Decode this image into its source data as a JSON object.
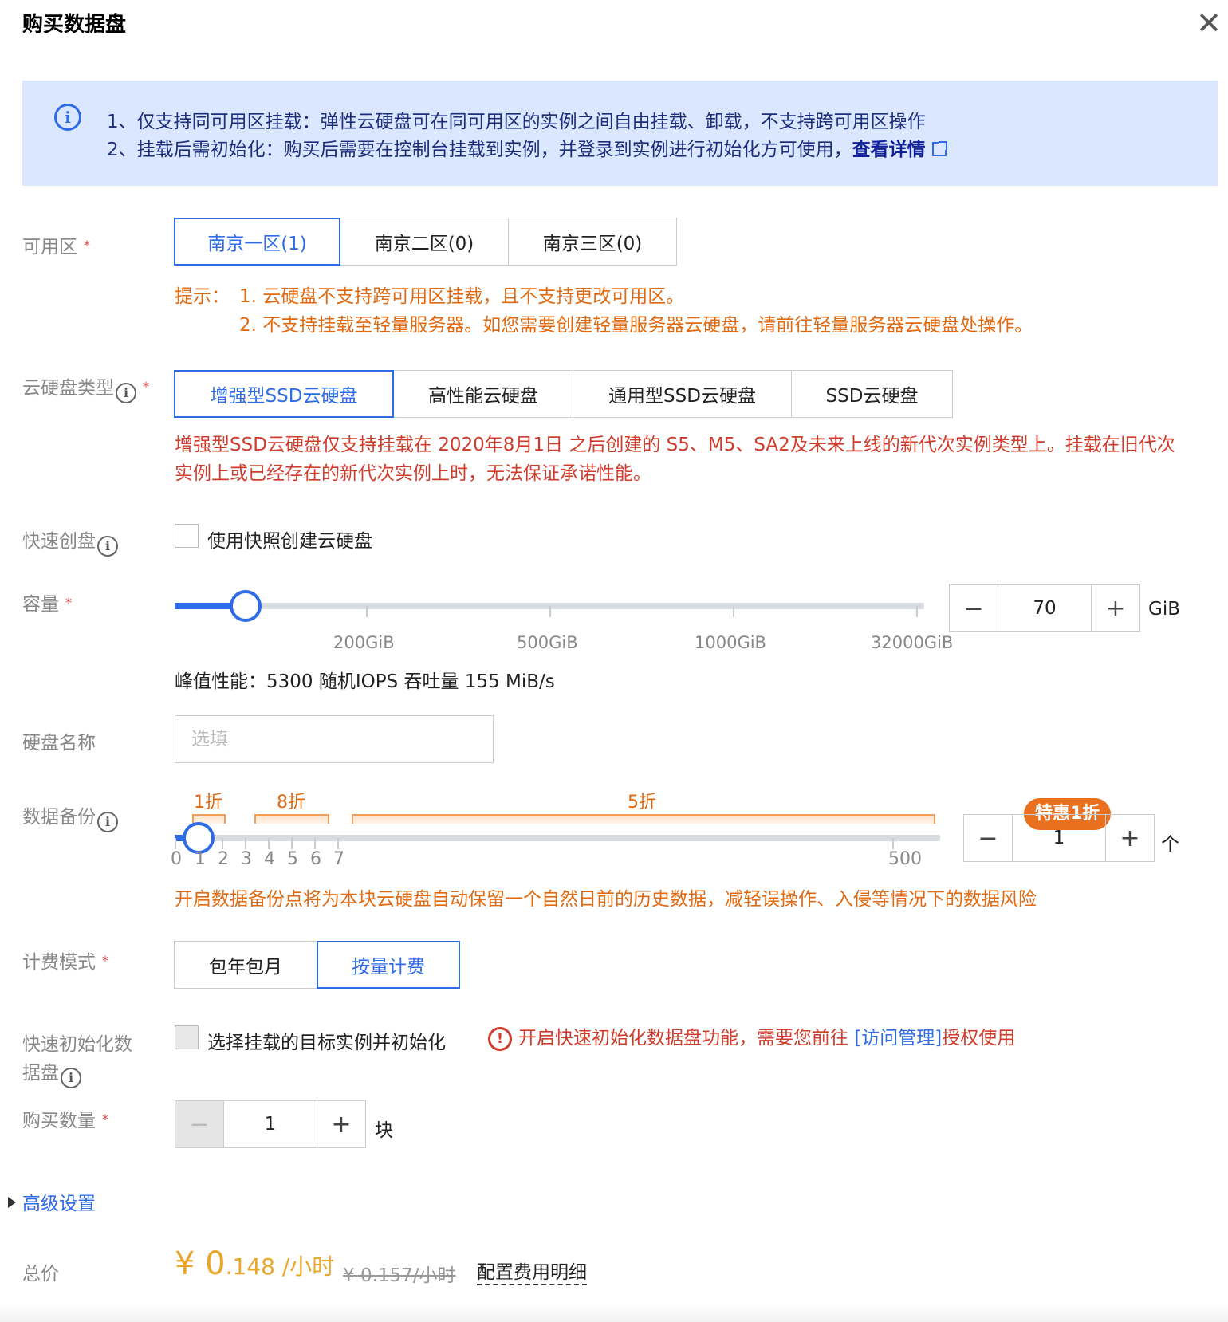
{
  "dialog": {
    "title": "购买数据盘",
    "close_glyph": "✕"
  },
  "notice": {
    "line1": "1、仅支持同可用区挂载：弹性云硬盘可在同可用区的实例之间自由挂载、卸载，不支持跨可用区操作",
    "line2": "2、挂载后需初始化：购买后需要在控制台挂载到实例，并登录到实例进行初始化方可使用，",
    "link": "查看详情"
  },
  "zone": {
    "label": "可用区",
    "options": [
      "南京一区(1)",
      "南京二区(0)",
      "南京三区(0)"
    ],
    "selected": "南京一区(1)",
    "tip_prefix": "提示：",
    "tip1": "1. 云硬盘不支持跨可用区挂载，且不支持更改可用区。",
    "tip2": "2. 不支持挂载至轻量服务器。如您需要创建轻量服务器云硬盘，请前往轻量服务器云硬盘处操作。"
  },
  "disk_type": {
    "label": "云硬盘类型",
    "options": [
      "增强型SSD云硬盘",
      "高性能云硬盘",
      "通用型SSD云硬盘",
      "SSD云硬盘"
    ],
    "selected": "增强型SSD云硬盘",
    "warning": "增强型SSD云硬盘仅支持挂载在 2020年8月1日 之后创建的 S5、M5、SA2及未来上线的新代次实例类型上。挂载在旧代次实例上或已经存在的新代次实例上时，无法保证承诺性能。"
  },
  "quick_create": {
    "label": "快速创盘",
    "checkbox_label": "使用快照创建云硬盘",
    "checked": false
  },
  "capacity": {
    "label": "容量",
    "ticks": [
      "200GiB",
      "500GiB",
      "1000GiB",
      "32000GiB"
    ],
    "slider_fraction": 0.095,
    "value": "70",
    "unit": "GiB",
    "perf": "峰值性能：5300 随机IOPS 吞吐量 155 MiB/s"
  },
  "disk_name": {
    "label": "硬盘名称",
    "placeholder": "选填"
  },
  "backup": {
    "label": "数据备份",
    "discounts": [
      "1折",
      "8折",
      "5折"
    ],
    "badge": "特惠1折",
    "ticks": [
      "0",
      "1",
      "2",
      "3",
      "4",
      "5",
      "6",
      "7",
      "500"
    ],
    "slider_value": 1,
    "value": "1",
    "unit": "个",
    "hint": "开启数据备份点将为本块云硬盘自动保留一个自然日前的历史数据，减轻误操作、入侵等情况下的数据风险"
  },
  "billing": {
    "label": "计费模式",
    "options": [
      "包年包月",
      "按量计费"
    ],
    "selected": "按量计费"
  },
  "quick_init": {
    "label_line1": "快速初始化数",
    "label_line2": "据盘",
    "checkbox_label": "选择挂载的目标实例并初始化",
    "warn_prefix": "开启快速初始化数据盘功能，需要您前往 ",
    "warn_link": "[访问管理]",
    "warn_suffix": "授权使用"
  },
  "quantity": {
    "label": "购买数量",
    "value": "1",
    "unit": "块"
  },
  "advanced": {
    "label": "高级设置"
  },
  "price": {
    "label": "总价",
    "currency": "¥",
    "main": "0",
    "decimal": ".148",
    "per": " /小时",
    "old": "¥ 0.157/小时",
    "detail": "配置费用明细"
  },
  "colors": {
    "accent": "#2e6be6",
    "warning": "#e06a12",
    "error": "#cf3c2c",
    "price": "#e8a72a"
  }
}
